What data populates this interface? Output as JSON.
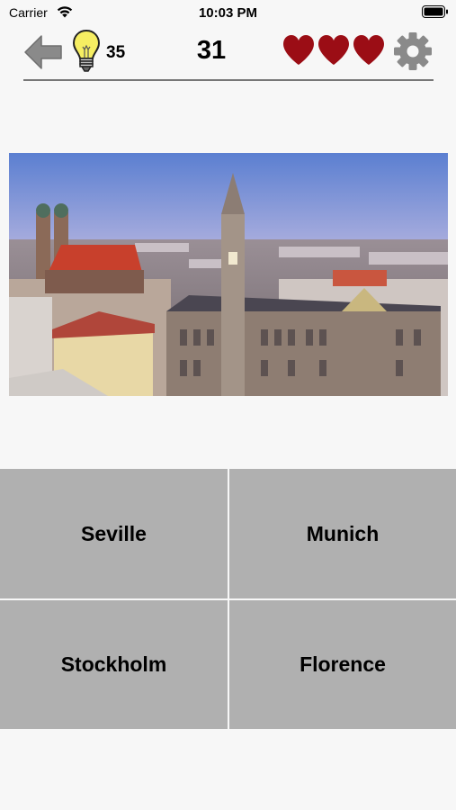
{
  "status_bar": {
    "carrier": "Carrier",
    "time": "10:03 PM"
  },
  "top_bar": {
    "back_icon": "arrow-left-icon",
    "hint_icon": "lightbulb-icon",
    "hint_count": "35",
    "score": "31",
    "lives": 3,
    "life_icon": "heart-icon",
    "settings_icon": "gear-icon"
  },
  "colors": {
    "heart": "#9b0d15",
    "icon_gray": "#8a8a8a",
    "answer_bg": "#b0b0b0",
    "background": "#f7f7f7"
  },
  "answers": [
    {
      "label": "Seville"
    },
    {
      "label": "Munich"
    },
    {
      "label": "Stockholm"
    },
    {
      "label": "Florence"
    }
  ]
}
